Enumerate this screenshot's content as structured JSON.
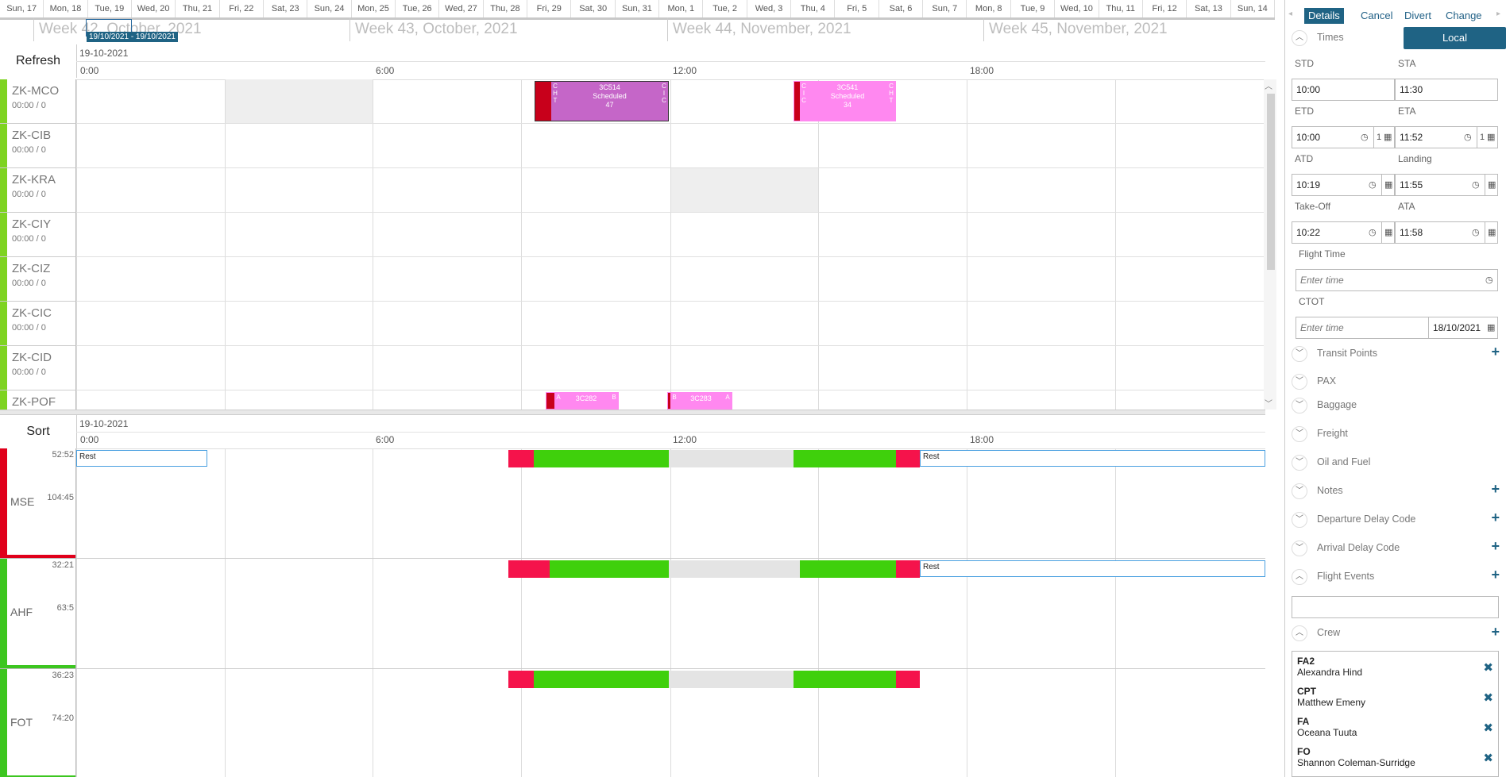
{
  "timeline": {
    "days": [
      "Sun, 17",
      "Mon, 18",
      "Tue, 19",
      "Wed, 20",
      "Thu, 21",
      "Fri, 22",
      "Sat, 23",
      "Sun, 24",
      "Mon, 25",
      "Tue, 26",
      "Wed, 27",
      "Thu, 28",
      "Fri, 29",
      "Sat, 30",
      "Sun, 31",
      "Mon, 1",
      "Tue, 2",
      "Wed, 3",
      "Thu, 4",
      "Fri, 5",
      "Sat, 6",
      "Sun, 7",
      "Mon, 8",
      "Tue, 9",
      "Wed, 10",
      "Thu, 11",
      "Fri, 12",
      "Sat, 13",
      "Sun, 14"
    ],
    "weeks": [
      "Week 42, October, 2021",
      "Week 43, October, 2021",
      "Week 44, November, 2021",
      "Week 45, November, 2021"
    ],
    "selection_tooltip": "19/10/2021 - 19/10/2021"
  },
  "aircraft_panel": {
    "refresh_label": "Refresh",
    "date": "19-10-2021",
    "hours": [
      "0:00",
      "6:00",
      "12:00",
      "18:00"
    ],
    "rows": [
      {
        "reg": "ZK-MCO",
        "sub": "00:00 / 0"
      },
      {
        "reg": "ZK-CIB",
        "sub": "00:00 / 0"
      },
      {
        "reg": "ZK-KRA",
        "sub": "00:00 / 0"
      },
      {
        "reg": "ZK-CIY",
        "sub": "00:00 / 0"
      },
      {
        "reg": "ZK-CIZ",
        "sub": "00:00 / 0"
      },
      {
        "reg": "ZK-CIC",
        "sub": "00:00 / 0"
      },
      {
        "reg": "ZK-CID",
        "sub": "00:00 / 0"
      },
      {
        "reg": "ZK-POF",
        "sub": ""
      }
    ],
    "flights": [
      {
        "number": "3C514",
        "status": "Scheduled",
        "pax": "47",
        "left_code": "C H T",
        "right_code": "C I C"
      },
      {
        "number": "3C541",
        "status": "Scheduled",
        "pax": "34",
        "left_code": "C I C",
        "right_code": "C H T"
      },
      {
        "number": "3C282",
        "status": "",
        "pax": "",
        "left_code": "A",
        "right_code": "B"
      },
      {
        "number": "3C283",
        "status": "",
        "pax": "",
        "left_code": "B",
        "right_code": "A"
      }
    ]
  },
  "crew_panel": {
    "sort_label": "Sort",
    "date": "19-10-2021",
    "hours": [
      "0:00",
      "6:00",
      "12:00",
      "18:00"
    ],
    "rows": [
      {
        "code": "MSE",
        "top": "52:52",
        "mid": "104:45",
        "color": "#e0001b",
        "rest_labels": [
          "Rest",
          "Rest"
        ]
      },
      {
        "code": "AHF",
        "top": "32:21",
        "mid": "63:5",
        "color": "#3cc61f",
        "rest_labels": [
          "Rest"
        ]
      },
      {
        "code": "FOT",
        "top": "36:23",
        "mid": "74:20",
        "color": "#3cc61f",
        "rest_labels": []
      }
    ]
  },
  "details": {
    "tabs": [
      "Details",
      "Cancel",
      "Divert",
      "Change"
    ],
    "times_label": "Times",
    "local_button": "Local",
    "std_label": "STD",
    "sta_label": "STA",
    "std": "10:00",
    "sta": "11:30",
    "etd_label": "ETD",
    "eta_label": "ETA",
    "etd": "10:00",
    "etd_day": "1",
    "eta": "11:52",
    "eta_day": "1",
    "atd_label": "ATD",
    "landing_label": "Landing",
    "atd": "10:19",
    "landing": "11:55",
    "takeoff_label": "Take-Off",
    "ata_label": "ATA",
    "takeoff": "10:22",
    "ata": "11:58",
    "flight_time_label": "Flight Time",
    "flight_time_placeholder": "Enter time",
    "ctot_label": "CTOT",
    "ctot_placeholder": "Enter time",
    "ctot_date": "18/10/2021",
    "sections": [
      "Transit Points",
      "PAX",
      "Baggage",
      "Freight",
      "Oil and Fuel",
      "Notes",
      "Departure Delay Code",
      "Arrival Delay Code",
      "Flight Events"
    ],
    "crew_label": "Crew",
    "crew": [
      {
        "role": "FA2",
        "name": "Alexandra Hind"
      },
      {
        "role": "CPT",
        "name": "Matthew Emeny"
      },
      {
        "role": "FA",
        "name": "Oceana Tuuta"
      },
      {
        "role": "FO",
        "name": "Shannon Coleman-Surridge"
      }
    ]
  },
  "colors": {
    "accent": "#1f6384",
    "flight_magenta": "#ff88f0",
    "flight_selected": "#c566c8",
    "duty_green": "#3fd00c",
    "duty_red": "#f5134b",
    "aircraft_bar": "#7ed321"
  }
}
